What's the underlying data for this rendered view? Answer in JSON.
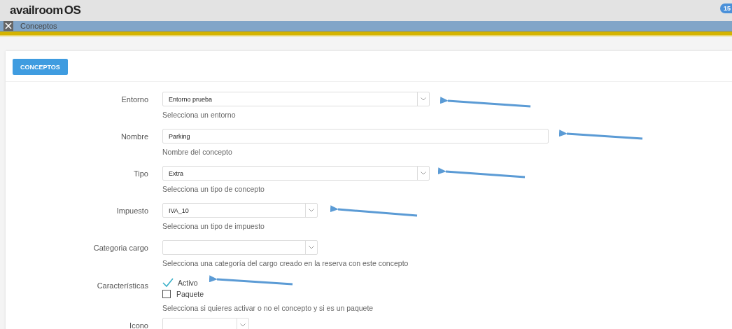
{
  "header": {
    "logo_text": "availroom",
    "logo_suffix": "OS",
    "badge": "15"
  },
  "tab_bar": {
    "title": "Conceptos"
  },
  "panel": {
    "button": "CONCEPTOS"
  },
  "form": [
    {
      "kind": "select",
      "label": "Entorno",
      "value": "Entorno prueba",
      "hint": "Selecciona un entorno"
    },
    {
      "kind": "input",
      "label": "Nombre",
      "value": "Parking",
      "hint": "Nombre del concepto"
    },
    {
      "kind": "select",
      "label": "Tipo",
      "value": "Extra",
      "hint": "Selecciona un tipo de concepto"
    },
    {
      "kind": "select",
      "label": "Impuesto",
      "value": "IVA_10",
      "hint": "Selecciona un tipo de impuesto"
    },
    {
      "kind": "select",
      "label": "Categoria cargo",
      "hint": "Selecciona una categoría del cargo creado en la reserva con este concepto"
    },
    {
      "kind": "checks",
      "label": "Características",
      "options": [
        {
          "label": "Activo",
          "checked": true
        },
        {
          "label": "Paquete",
          "checked": false
        }
      ],
      "hint": "Selecciona si quieres activar o no el concepto y si es un paquete"
    },
    {
      "kind": "select",
      "label": "Icono"
    }
  ]
}
